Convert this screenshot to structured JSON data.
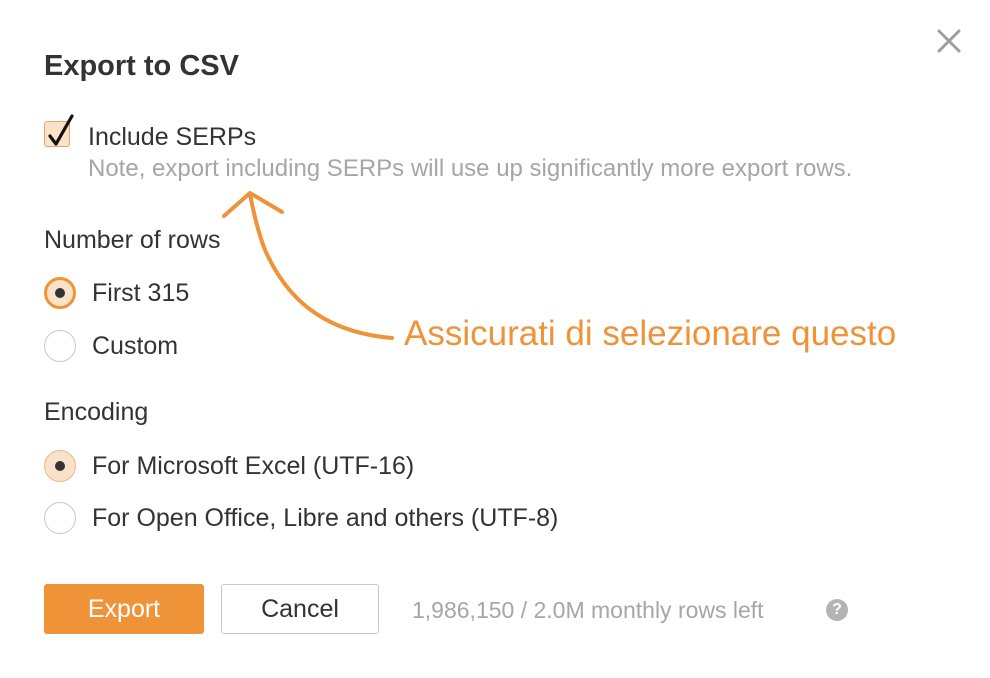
{
  "dialog": {
    "title": "Export to CSV",
    "close_icon": "close-icon",
    "include_serps": {
      "label": "Include SERPs",
      "checked": true,
      "note": "Note, export including SERPs will use up significantly more export rows."
    },
    "number_of_rows": {
      "label": "Number of rows",
      "options": [
        {
          "label": "First 315",
          "checked": true
        },
        {
          "label": "Custom",
          "checked": false
        }
      ]
    },
    "encoding": {
      "label": "Encoding",
      "options": [
        {
          "label": "For Microsoft Excel (UTF-16)",
          "checked": true
        },
        {
          "label": "For Open Office, Libre and others (UTF-8)",
          "checked": false
        }
      ]
    },
    "buttons": {
      "export_label": "Export",
      "cancel_label": "Cancel"
    },
    "rows_left": "1,986,150 / 2.0M monthly rows left",
    "help_icon": "question-mark-icon",
    "help_glyph": "?"
  },
  "annotation": {
    "text": "Assicurati di selezionare questo",
    "color": "#ef9339"
  },
  "colors": {
    "accent": "#ef9339",
    "checked_bg": "#fae2c9",
    "muted_text": "#a6a6a6",
    "text": "#333333"
  }
}
